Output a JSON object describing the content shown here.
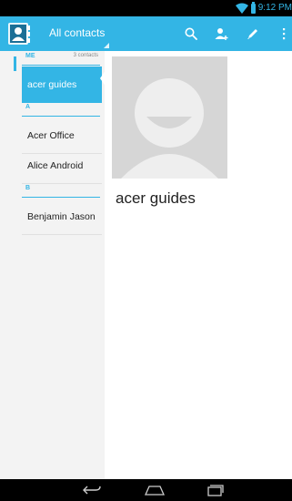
{
  "status_bar": {
    "time": "9:12 PM"
  },
  "action_bar": {
    "title": "All contacts",
    "icons": [
      "contacts-app-icon",
      "search-icon",
      "add-contact-icon",
      "edit-icon",
      "overflow-menu-icon"
    ]
  },
  "contacts_list": {
    "me_section": {
      "letter": "ME",
      "count": "3 contacts"
    },
    "me_contact": "acer guides",
    "section_a": "A",
    "section_a_contacts": [
      "Acer Office",
      "Alice Android"
    ],
    "section_b": "B",
    "section_b_contacts": [
      "Benjamin Jason"
    ]
  },
  "contact_detail": {
    "name": "acer guides"
  },
  "colors": {
    "accent": "#33b5e5",
    "list_background": "#f3f3f3",
    "detail_background": "#ffffff"
  },
  "nav_bar": {
    "icons": [
      "back-icon",
      "home-icon",
      "recent-apps-icon"
    ]
  }
}
